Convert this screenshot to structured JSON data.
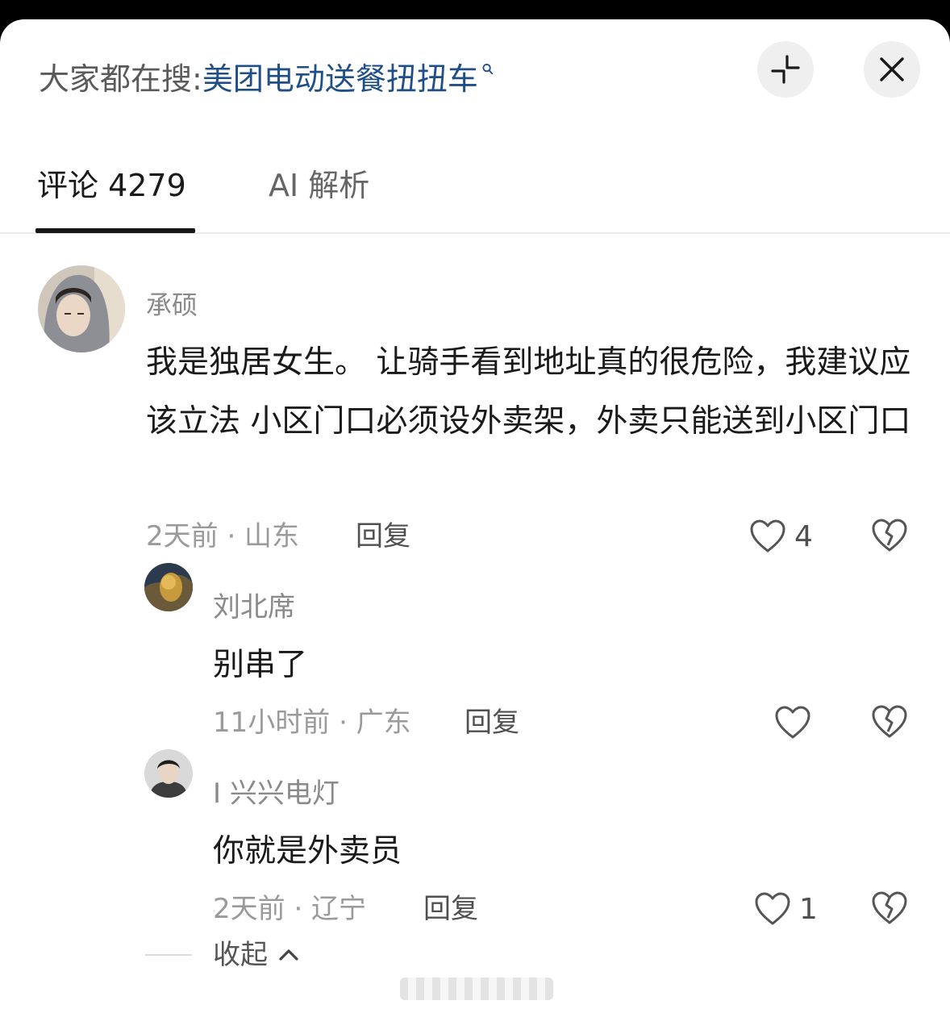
{
  "header": {
    "search_prefix": "大家都在搜:",
    "search_query": "美团电动送餐扭扭车",
    "collapse_icon": "collapse-icon",
    "close_icon": "close-icon"
  },
  "tabs": [
    {
      "label": "评论 4279",
      "active": true
    },
    {
      "label": "AI 解析",
      "active": false
    }
  ],
  "comments": [
    {
      "username": "承硕",
      "text": "我是独居女生。 让骑手看到地址真的很危险，我建议应该立法 小区门口必须设外卖架，外卖只能送到小区门口",
      "meta": "2天前 · 山东",
      "reply": "回复",
      "likes": "4"
    },
    {
      "username": "刘北席",
      "text": "别串了",
      "meta": "11小时前 · 广东",
      "reply": "回复",
      "likes": ""
    },
    {
      "username": "I 兴兴电灯",
      "text": "你就是外卖员",
      "meta": "2天前 · 辽宁",
      "reply": "回复",
      "likes": "1"
    }
  ],
  "collapse": {
    "label": "收起"
  },
  "colors": {
    "link": "#1f4f86",
    "text": "#1a1a1a",
    "muted": "#9a9a9a"
  }
}
